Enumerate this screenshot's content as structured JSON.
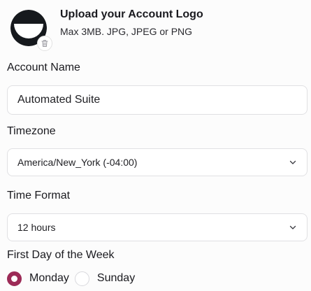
{
  "upload": {
    "title": "Upload your Account Logo",
    "subtitle": "Max 3MB. JPG, JPEG or PNG"
  },
  "account_name": {
    "label": "Account Name",
    "value": "Automated Suite"
  },
  "timezone": {
    "label": "Timezone",
    "value": "America/New_York (-04:00)"
  },
  "time_format": {
    "label": "Time Format",
    "value": "12 hours"
  },
  "first_day": {
    "label": "First Day of the Week",
    "options": [
      {
        "label": "Monday",
        "checked": true
      },
      {
        "label": "Sunday",
        "checked": false
      }
    ]
  },
  "colors": {
    "accent": "#9c2b57",
    "border": "#e0e0e3",
    "logo_dark": "#16191d"
  },
  "icons": [
    "logo-image",
    "trash-icon",
    "chevron-down-icon"
  ]
}
